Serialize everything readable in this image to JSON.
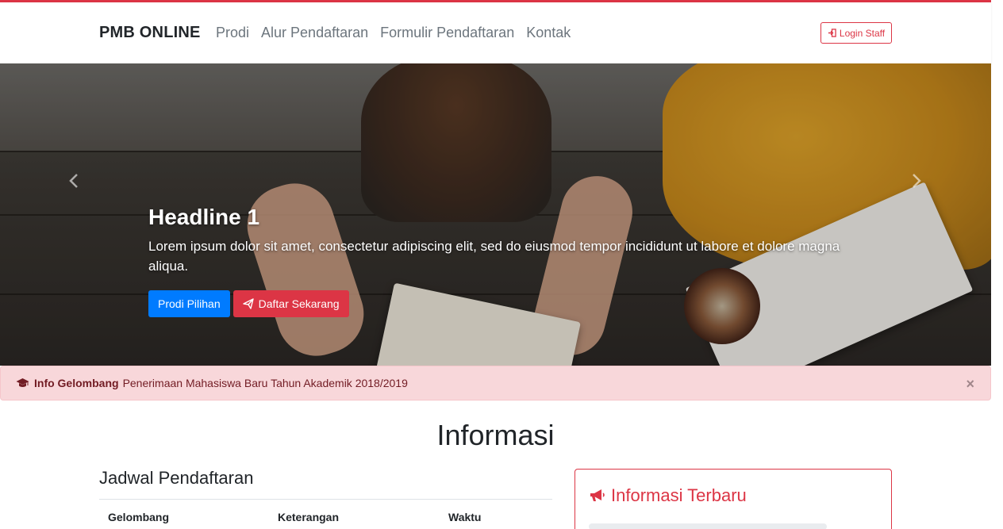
{
  "colors": {
    "accent": "#dc3545",
    "primary": "#007bff",
    "alert_bg": "#f8d7da",
    "alert_text": "#721c24"
  },
  "navbar": {
    "brand": "PMB ONLINE",
    "links": [
      "Prodi",
      "Alur Pendaftaran",
      "Formulir Pendaftaran",
      "Kontak"
    ],
    "login_label": "Login Staff",
    "login_icon": "sign-in-icon"
  },
  "hero": {
    "headline": "Headline 1",
    "text": "Lorem ipsum dolor sit amet, consectetur adipiscing elit, sed do eiusmod tempor incididunt ut labore et dolore magna aliqua.",
    "btn_primary": "Prodi Pilihan",
    "btn_danger": "Daftar Sekarang",
    "btn_danger_icon": "paper-plane-icon"
  },
  "alert": {
    "icon": "graduation-cap-icon",
    "title": "Info Gelombang",
    "message": "Penerimaan Mahasiswa Baru Tahun Akademik 2018/2019",
    "close": "×"
  },
  "section": {
    "title": "Informasi",
    "jadwal": {
      "title": "Jadwal Pendaftaran",
      "columns": [
        "Gelombang",
        "Keterangan",
        "Waktu"
      ]
    },
    "terbaru": {
      "icon": "bullhorn-icon",
      "title": "Informasi Terbaru"
    }
  }
}
